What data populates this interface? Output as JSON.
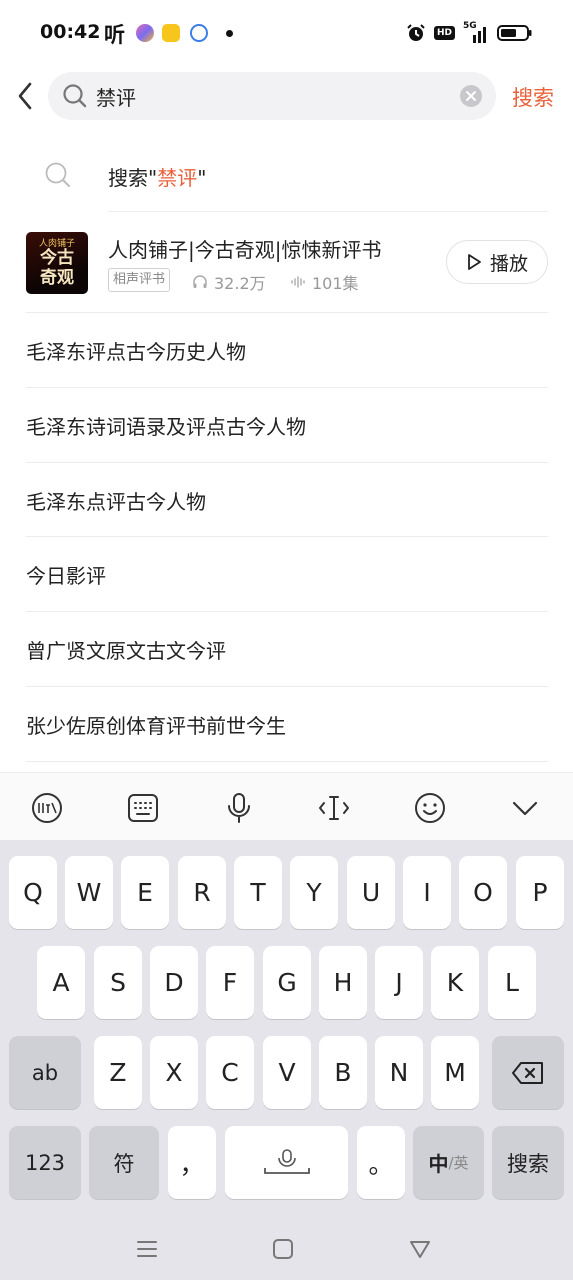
{
  "status_bar": {
    "time": "00:42",
    "app_glyph": "听",
    "battery_icon": "battery-icon",
    "signal_label": "5G",
    "hd_label": "HD"
  },
  "header": {
    "back_icon": "chevron-left-icon",
    "search_value": "禁评",
    "search_button": "搜索"
  },
  "top_suggestion": {
    "prefix": "搜索\"",
    "keyword": "禁评",
    "suffix": "\""
  },
  "album": {
    "cover_line1": "人肉铺子",
    "cover_line2": "今古",
    "cover_line3": "奇观",
    "title": "人肉铺子|今古奇观|惊悚新评书",
    "tag": "相声评书",
    "plays": "32.2万",
    "episodes": "101集",
    "play_label": "播放"
  },
  "suggestions": [
    "毛泽东评点古今历史人物",
    "毛泽东诗词语录及评点古今人物",
    "毛泽东点评古今人物",
    "今日影评",
    "曾广贤文原文古文今评",
    "张少佐原创体育评书前世今生"
  ],
  "keyboard": {
    "row1": [
      "Q",
      "W",
      "E",
      "R",
      "T",
      "Y",
      "U",
      "I",
      "O",
      "P"
    ],
    "row2": [
      "A",
      "S",
      "D",
      "F",
      "G",
      "H",
      "J",
      "K",
      "L"
    ],
    "row3": [
      "Z",
      "X",
      "C",
      "V",
      "B",
      "N",
      "M"
    ],
    "shift_label": "ab",
    "num_label": "123",
    "symbol_label": "符",
    "comma_label": "，",
    "period_label": "。",
    "lang_main": "中",
    "lang_alt": "/英",
    "enter_label": "搜索"
  },
  "colors": {
    "accent": "#e8613a",
    "keyboard_bg": "#e4e4ea",
    "key_dark": "#cfcfd6"
  }
}
